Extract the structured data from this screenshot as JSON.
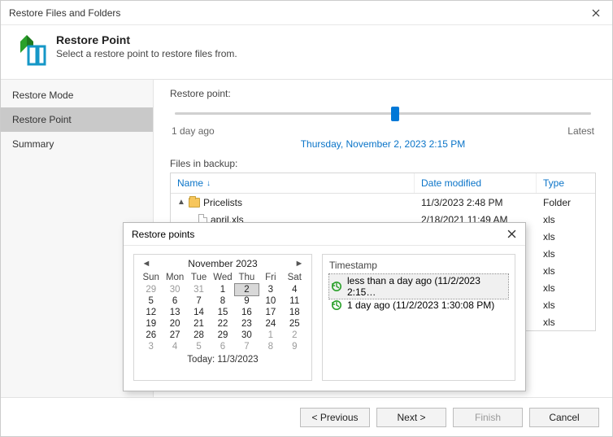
{
  "window": {
    "title": "Restore Files and Folders"
  },
  "header": {
    "title": "Restore Point",
    "subtitle": "Select a restore point to restore files from."
  },
  "sidebar": {
    "items": [
      {
        "label": "Restore Mode",
        "selected": false
      },
      {
        "label": "Restore Point",
        "selected": true
      },
      {
        "label": "Summary",
        "selected": false
      }
    ]
  },
  "slider": {
    "label": "Restore point:",
    "left_label": "1 day ago",
    "right_label": "Latest",
    "selected_label": "Thursday, November 2, 2023 2:15 PM",
    "position_pct": 52
  },
  "files": {
    "label": "Files in backup:",
    "columns": {
      "name": "Name",
      "date": "Date modified",
      "type": "Type"
    },
    "sort": {
      "column": "name",
      "direction": "asc"
    },
    "rows": [
      {
        "indent": 0,
        "expander": "▲",
        "icon": "folder",
        "name": "Pricelists",
        "date": "11/3/2023 2:48 PM",
        "type": "Folder"
      },
      {
        "indent": 1,
        "icon": "file",
        "name": "april.xls",
        "date": "2/18/2021 11:49 AM",
        "type": "xls"
      },
      {
        "indent": 1,
        "icon": "file",
        "name": "",
        "date": "",
        "type": "xls"
      },
      {
        "indent": 1,
        "icon": "file",
        "name": "",
        "date": "",
        "type": "xls"
      },
      {
        "indent": 1,
        "icon": "file",
        "name": "",
        "date": "",
        "type": "xls"
      },
      {
        "indent": 1,
        "icon": "file",
        "name": "",
        "date": "",
        "type": "xls"
      },
      {
        "indent": 1,
        "icon": "file",
        "name": "",
        "date": "",
        "type": "xls"
      },
      {
        "indent": 1,
        "icon": "file",
        "name": "",
        "date": "",
        "type": "xls"
      }
    ]
  },
  "popup": {
    "title": "Restore points",
    "calendar": {
      "month_label": "November 2023",
      "dow": [
        "Sun",
        "Mon",
        "Tue",
        "Wed",
        "Thu",
        "Fri",
        "Sat"
      ],
      "today_label": "Today: 11/3/2023",
      "selected_day": 2,
      "weeks": [
        [
          {
            "n": 29,
            "muted": true
          },
          {
            "n": 30,
            "muted": true
          },
          {
            "n": 31,
            "muted": true
          },
          {
            "n": 1
          },
          {
            "n": 2,
            "selected": true
          },
          {
            "n": 3
          },
          {
            "n": 4
          }
        ],
        [
          {
            "n": 5
          },
          {
            "n": 6
          },
          {
            "n": 7
          },
          {
            "n": 8
          },
          {
            "n": 9
          },
          {
            "n": 10
          },
          {
            "n": 11
          }
        ],
        [
          {
            "n": 12
          },
          {
            "n": 13
          },
          {
            "n": 14
          },
          {
            "n": 15
          },
          {
            "n": 16
          },
          {
            "n": 17
          },
          {
            "n": 18
          }
        ],
        [
          {
            "n": 19
          },
          {
            "n": 20
          },
          {
            "n": 21
          },
          {
            "n": 22
          },
          {
            "n": 23
          },
          {
            "n": 24
          },
          {
            "n": 25
          }
        ],
        [
          {
            "n": 26
          },
          {
            "n": 27
          },
          {
            "n": 28
          },
          {
            "n": 29
          },
          {
            "n": 30
          },
          {
            "n": 1,
            "muted": true
          },
          {
            "n": 2,
            "muted": true
          }
        ],
        [
          {
            "n": 3,
            "muted": true
          },
          {
            "n": 4,
            "muted": true
          },
          {
            "n": 5,
            "muted": true
          },
          {
            "n": 6,
            "muted": true
          },
          {
            "n": 7,
            "muted": true
          },
          {
            "n": 8,
            "muted": true
          },
          {
            "n": 9,
            "muted": true
          }
        ]
      ]
    },
    "timestamps": {
      "header": "Timestamp",
      "items": [
        {
          "label": "less than a day ago (11/2/2023 2:15…",
          "selected": true
        },
        {
          "label": "1 day ago (11/2/2023 1:30:08 PM)",
          "selected": false
        }
      ]
    }
  },
  "footer": {
    "previous": "< Previous",
    "next": "Next >",
    "finish": "Finish",
    "cancel": "Cancel"
  }
}
